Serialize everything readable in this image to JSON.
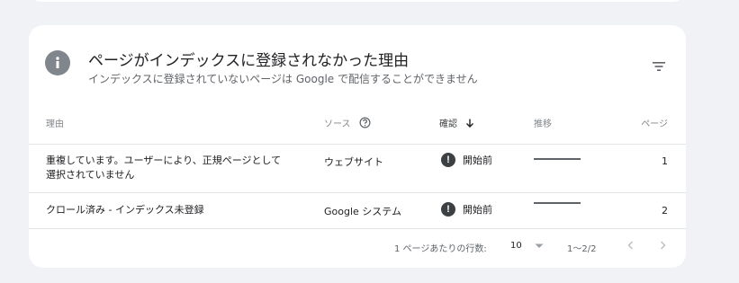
{
  "card": {
    "title": "ページがインデックスに登録されなかった理由",
    "subtitle": "インデックスに登録されていないページは Google で配信することができません"
  },
  "table": {
    "headers": {
      "reason": "理由",
      "source": "ソース",
      "validation": "確認",
      "trend": "推移",
      "pages": "ページ"
    },
    "rows": [
      {
        "reason": "重複しています。ユーザーにより、正規ページとして選択されていません",
        "source": "ウェブサイト",
        "validation": "開始前",
        "pages": "1"
      },
      {
        "reason": "クロール済み - インデックス未登録",
        "source": "Google システム",
        "validation": "開始前",
        "pages": "2"
      }
    ]
  },
  "pagination": {
    "rows_per_page_label": "1 ページあたりの行数:",
    "rows_per_page_value": "10",
    "range": "1〜2/2"
  },
  "icons": {
    "info": "info-icon",
    "filter": "filter-icon",
    "help": "help-icon",
    "sort": "arrow-down-icon",
    "status": "exclamation-icon",
    "dropdown": "caret-down-icon",
    "prev": "chevron-left-icon",
    "next": "chevron-right-icon"
  }
}
